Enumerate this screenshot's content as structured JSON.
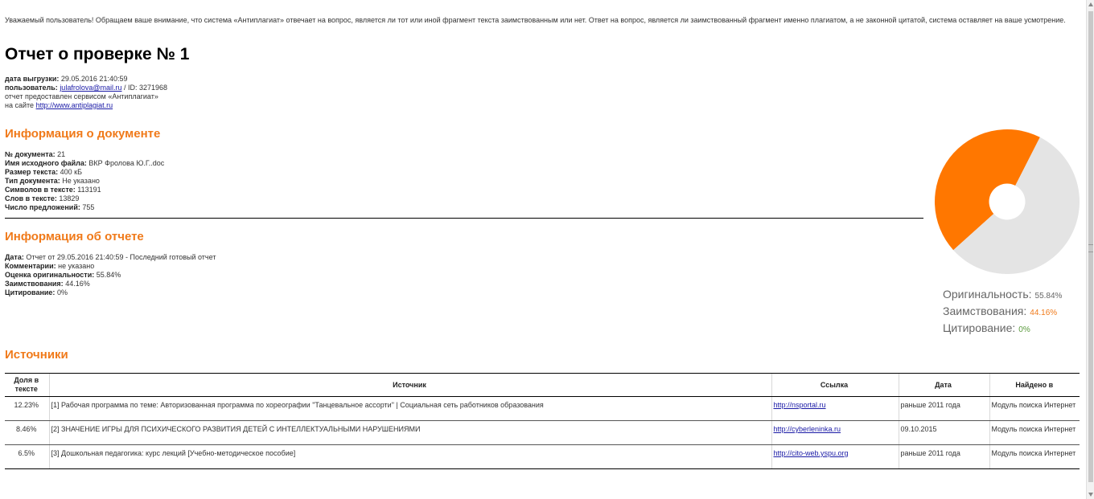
{
  "notice": "Уважаемый пользователь! Обращаем ваше внимание, что система «Антиплагиат» отвечает на вопрос, является ли тот или иной фрагмент текста заимствованным или нет. Ответ на вопрос, является ли заимствованный фрагмент именно плагиатом, а не законной цитатой, система оставляет на ваше усмотрение.",
  "title": "Отчет о проверке № 1",
  "meta": {
    "upload_date_label": "дата выгрузки:",
    "upload_date": "29.05.2016 21:40:59",
    "user_label": "пользователь:",
    "user_email": "julafrolova@mail.ru",
    "user_id": "/ ID: 3271968",
    "provided_by": "отчет предоставлен сервисом «Антиплагиат»",
    "site_label": "на сайте",
    "site_url": "http://www.antiplagiat.ru"
  },
  "document_info": {
    "heading": "Информация о документе",
    "rows": [
      {
        "label": "№ документа:",
        "value": "21"
      },
      {
        "label": "Имя исходного файла:",
        "value": "ВКР Фролова Ю.Г..doc"
      },
      {
        "label": "Размер текста:",
        "value": "400 кБ"
      },
      {
        "label": "Тип документа:",
        "value": "Не указано"
      },
      {
        "label": "Символов в тексте:",
        "value": "113191"
      },
      {
        "label": "Слов в тексте:",
        "value": "13829"
      },
      {
        "label": "Число предложений:",
        "value": "755"
      }
    ]
  },
  "report_info": {
    "heading": "Информация об отчете",
    "rows": [
      {
        "label": "Дата:",
        "value": "Отчет от 29.05.2016 21:40:59 - Последний готовый отчет"
      },
      {
        "label": "Комментарии:",
        "value": "не указано"
      },
      {
        "label": "Оценка оригинальности:",
        "value": "55.84%"
      },
      {
        "label": "Заимствования:",
        "value": "44.16%"
      },
      {
        "label": "Цитирование:",
        "value": "0%"
      }
    ]
  },
  "pie": {
    "slices": [
      {
        "name": "Оригинальность:",
        "label": "55.84%",
        "value": 55.84,
        "color": "#e4e4e4",
        "label_color": "#666666"
      },
      {
        "name": "Заимствования:",
        "label": "44.16%",
        "value": 44.16,
        "color": "#ff7700",
        "label_color": "#f07a1a"
      },
      {
        "name": "Цитирование:",
        "label": "0%",
        "value": 0,
        "color": "#6aa84f",
        "label_color": "#5a9a3c"
      }
    ]
  },
  "sources": {
    "heading": "Источники",
    "columns": [
      "Доля в тексте",
      "Источник",
      "Ссылка",
      "Дата",
      "Найдено в"
    ],
    "rows": [
      {
        "share": "12.23%",
        "source": "[1] Рабочая программа по теме: Авторизованная программа по хореографии \"Танцевальное ассорти\" | Социальная сеть работников образования",
        "link": "http://nsportal.ru",
        "date": "раньше 2011 года",
        "found_in": "Модуль поиска Интернет"
      },
      {
        "share": "8.46%",
        "source": "[2] ЗНАЧЕНИЕ ИГРЫ ДЛЯ ПСИХИЧЕСКОГО РАЗВИТИЯ ДЕТЕЙ С ИНТЕЛЛЕКТУАЛЬНЫМИ НАРУШЕНИЯМИ",
        "link": "http://cyberleninka.ru",
        "date": "09.10.2015",
        "found_in": "Модуль поиска Интернет"
      },
      {
        "share": "6.5%",
        "source": "[3] Дошкольная педагогика: курс лекций [Учебно-методическое пособие]",
        "link": "http://cito-web.yspu.org",
        "date": "раньше 2011 года",
        "found_in": "Модуль поиска Интернет"
      }
    ]
  }
}
